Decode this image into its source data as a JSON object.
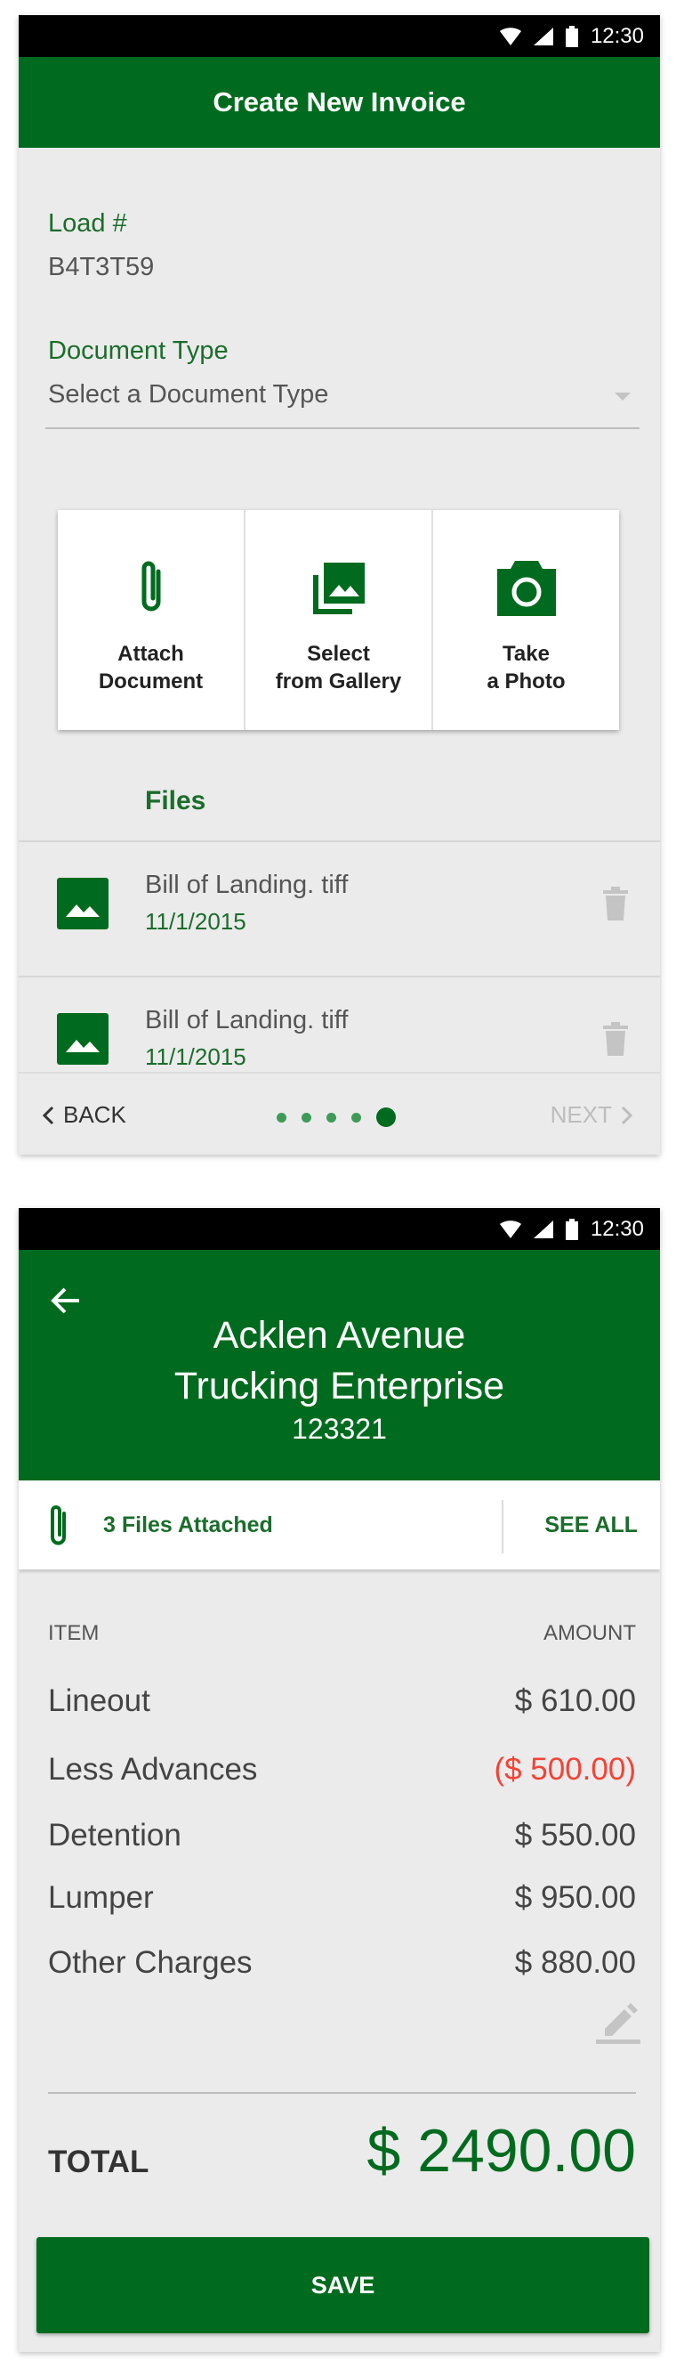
{
  "status_bar": {
    "time": "12:30"
  },
  "screen1": {
    "title": "Create New Invoice",
    "load_label": "Load #",
    "load_value": "B4T3T59",
    "doc_type_label": "Document Type",
    "doc_type_placeholder": "Select a Document Type",
    "actions": [
      {
        "label": "Attach\nDocument",
        "icon": "paperclip-icon"
      },
      {
        "label": "Select\nfrom Gallery",
        "icon": "gallery-icon"
      },
      {
        "label": "Take\na Photo",
        "icon": "camera-icon"
      }
    ],
    "files_title": "Files",
    "files": [
      {
        "name": "Bill of Landing. tiff",
        "date": "11/1/2015"
      },
      {
        "name": "Bill of Landing. tiff",
        "date": "11/1/2015"
      }
    ],
    "nav": {
      "back": "BACK",
      "next": "NEXT",
      "pages": 5,
      "current": 5
    }
  },
  "screen2": {
    "company": "Acklen Avenue\nTrucking Enterprise",
    "company_id": "123321",
    "files_attached": "3 Files Attached",
    "see_all": "SEE ALL",
    "col_item": "ITEM",
    "col_amount": "AMOUNT",
    "items": [
      {
        "desc": "Lineout",
        "amount": "$ 610.00",
        "negative": false
      },
      {
        "desc": "Less Advances",
        "amount": "($ 500.00)",
        "negative": true
      },
      {
        "desc": "Detention",
        "amount": "$ 550.00",
        "negative": false
      },
      {
        "desc": "Lumper",
        "amount": "$ 950.00",
        "negative": false
      },
      {
        "desc": "Other Charges",
        "amount": "$ 880.00",
        "negative": false
      }
    ],
    "total_label": "TOTAL",
    "total_value": "$ 2490.00",
    "save_label": "SAVE"
  },
  "colors": {
    "brand_green": "#006b1e",
    "negative_red": "#f44336"
  }
}
